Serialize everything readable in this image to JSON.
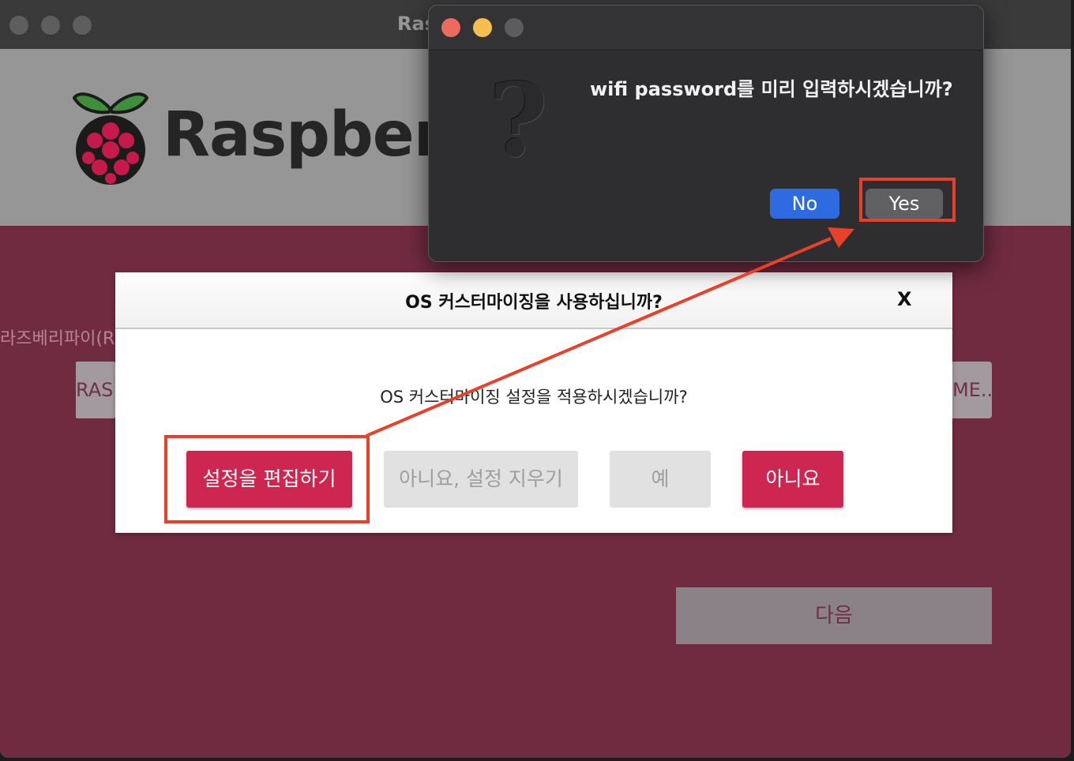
{
  "main_window": {
    "title": "Ras",
    "brand": "Raspberr",
    "section_label": "라즈베리파이(R",
    "os_button_label": "RAS",
    "storage_button_label": "ME..",
    "next_button_label": "다음"
  },
  "customize_dialog": {
    "title": "OS 커스터마이징을 사용하십니까?",
    "close_label": "X",
    "message": "OS 커스터마이징 설정을 적용하시겠습니까?",
    "buttons": {
      "edit": "설정을 편집하기",
      "clear": "아니요, 설정 지우기",
      "yes": "예",
      "no": "아니요"
    }
  },
  "alert": {
    "icon": "question-icon",
    "question_glyph": "?",
    "message": "wifi password를 미리 입력하시겠습니까?",
    "no_label": "No",
    "yes_label": "Yes"
  },
  "colors": {
    "raspberry": "#cd2651",
    "window_bg": "#712b41",
    "alert_no": "#2e6be0",
    "annotation": "#e8402a"
  }
}
